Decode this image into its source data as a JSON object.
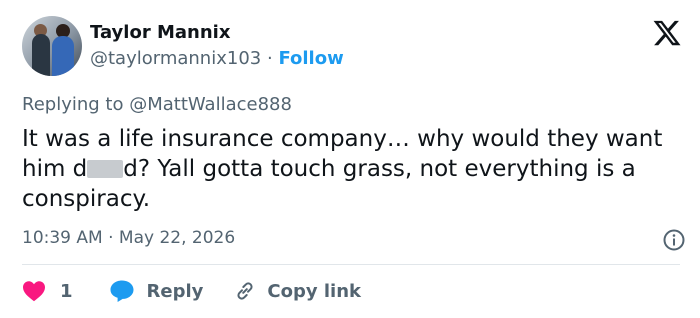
{
  "author": {
    "name": "Taylor Mannix",
    "handle": "@taylormannix103",
    "separator": "·",
    "follow_label": "Follow"
  },
  "reply_context": {
    "prefix": "Replying to",
    "mention": "@MattWallace888"
  },
  "tweet": {
    "text_before_redaction": "It was a life insurance company… why would they want him d",
    "text_after_redaction": "d? Yall gotta touch grass, not everything is a conspiracy."
  },
  "meta": {
    "time": "10:39 AM",
    "separator": "·",
    "date": "May 22, 2026"
  },
  "actions": {
    "like_count": "1",
    "reply_label": "Reply",
    "copy_label": "Copy link"
  },
  "colors": {
    "like": "#f91880",
    "reply": "#1d9bf0",
    "link": "#1d9bf0",
    "secondary_text": "#536471"
  },
  "icons": [
    "x-logo-icon",
    "info-icon",
    "heart-icon",
    "reply-bubble-icon",
    "link-icon"
  ]
}
